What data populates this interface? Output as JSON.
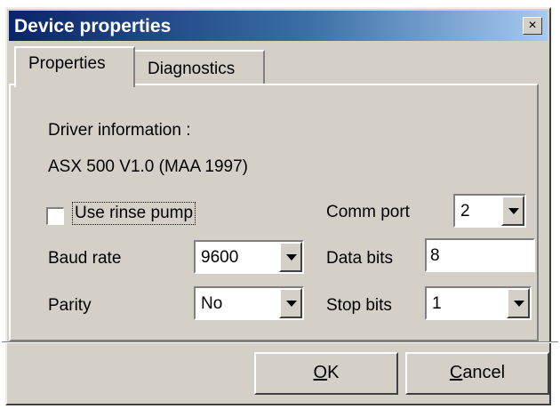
{
  "window": {
    "title": "Device properties",
    "close_glyph": "×"
  },
  "tabs": [
    {
      "label": "Properties",
      "active": true
    },
    {
      "label": "Diagnostics",
      "active": false
    }
  ],
  "driver": {
    "label": "Driver information :",
    "value": "ASX 500 V1.0 (MAA 1997)"
  },
  "rinse_pump": {
    "label": "Use rinse pump",
    "checked": false
  },
  "baud_rate": {
    "label": "Baud rate",
    "value": "9600"
  },
  "parity": {
    "label": "Parity",
    "value": "No"
  },
  "comm_port": {
    "label": "Comm port",
    "value": "2"
  },
  "data_bits": {
    "label": "Data bits",
    "value": "8"
  },
  "stop_bits": {
    "label": "Stop bits",
    "value": "1"
  },
  "buttons": {
    "ok": {
      "mnemonic": "O",
      "rest": "K"
    },
    "cancel": {
      "mnemonic": "C",
      "rest": "ancel"
    }
  },
  "icons": {
    "dropdown": "chevron-down-icon",
    "close": "close-icon"
  }
}
